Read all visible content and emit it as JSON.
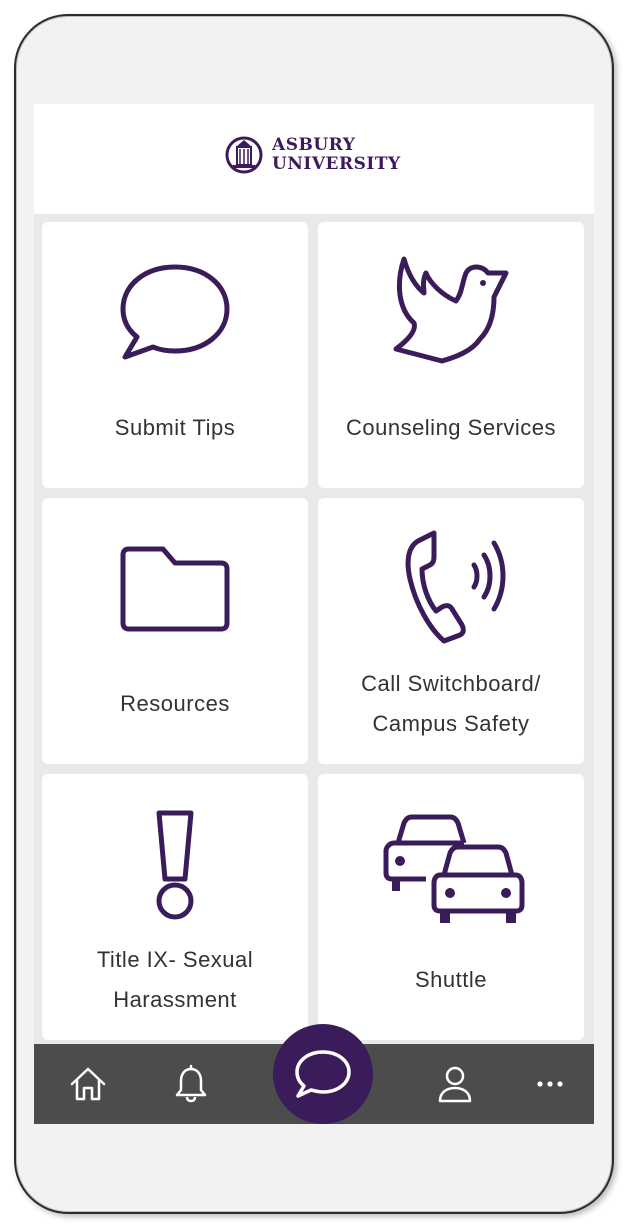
{
  "header": {
    "logo_line1": "ASBURY",
    "logo_line2": "UNIVERSITY"
  },
  "tiles": [
    {
      "label": "Submit Tips",
      "icon": "speech-bubble-icon"
    },
    {
      "label": "Counseling Services",
      "icon": "dove-icon"
    },
    {
      "label": "Resources",
      "icon": "folder-icon"
    },
    {
      "label_lines": [
        "Call Switchboard/",
        "Campus Safety"
      ],
      "icon": "phone-ringing-icon"
    },
    {
      "label_lines": [
        "Title IX- Sexual",
        "Harassment"
      ],
      "icon": "exclamation-icon"
    },
    {
      "label": "Shuttle",
      "icon": "cars-icon"
    }
  ],
  "nav": {
    "items": [
      {
        "icon": "home-icon"
      },
      {
        "icon": "bell-icon"
      },
      {
        "icon": "chat-icon"
      },
      {
        "icon": "user-icon"
      },
      {
        "icon": "more-icon"
      }
    ]
  },
  "colors": {
    "brand_purple": "#3b1c5a",
    "nav_bg": "#4c4c4c",
    "tile_bg": "#ffffff",
    "screen_bg": "#e9e9e9"
  }
}
